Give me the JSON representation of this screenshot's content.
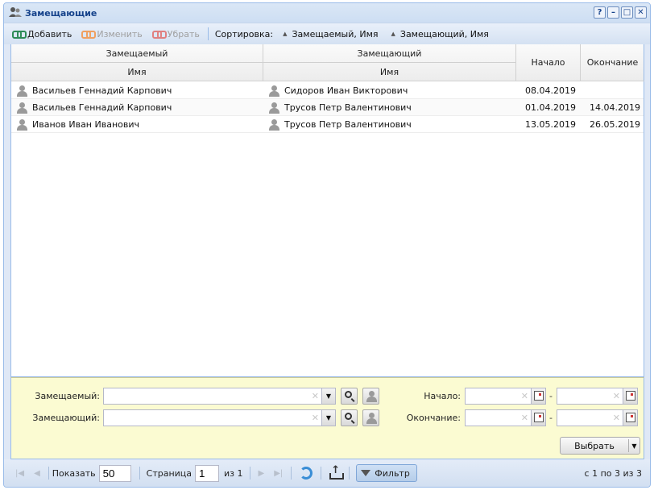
{
  "window": {
    "title": "Замещающие",
    "buttons": {
      "help": "?",
      "minimize": "–",
      "maximize": "□",
      "close": "✕"
    }
  },
  "toolbar": {
    "add_label": "Добавить",
    "edit_label": "Изменить",
    "remove_label": "Убрать",
    "sort_label": "Сортировка:",
    "sort_items": [
      "Замещаемый, Имя",
      "Замещающий, Имя"
    ]
  },
  "grid": {
    "group_headers": {
      "replaced": "Замещаемый",
      "replacer": "Замещающий"
    },
    "sub_headers": {
      "replaced_name": "Имя",
      "replacer_name": "Имя"
    },
    "columns": {
      "start": "Начало",
      "end": "Окончание"
    },
    "rows": [
      {
        "replaced": "Васильев Геннадий Карпович",
        "replacer": "Сидоров Иван Викторович",
        "start": "08.04.2019",
        "end": ""
      },
      {
        "replaced": "Васильев Геннадий Карпович",
        "replacer": "Трусов Петр Валентинович",
        "start": "01.04.2019",
        "end": "14.04.2019"
      },
      {
        "replaced": "Иванов Иван Иванович",
        "replacer": "Трусов Петр Валентинович",
        "start": "13.05.2019",
        "end": "26.05.2019"
      }
    ]
  },
  "filter": {
    "replaced_label": "Замещаемый:",
    "replacer_label": "Замещающий:",
    "start_label": "Начало:",
    "end_label": "Окончание:",
    "replaced_value": "",
    "replacer_value": "",
    "range_dash": "-",
    "select_label": "Выбрать"
  },
  "pager": {
    "show_label": "Показать",
    "page_size": "50",
    "page_label": "Страница",
    "page_value": "1",
    "of_label": "из 1",
    "filter_label": "Фильтр",
    "status": "с 1 по 3 из 3"
  }
}
